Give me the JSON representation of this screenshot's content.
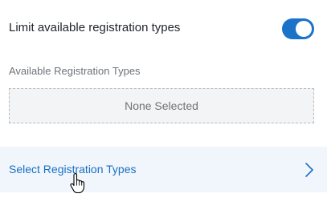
{
  "limit": {
    "label": "Limit available registration types",
    "toggle_on": true,
    "toggle_color": "#1a73c9"
  },
  "available": {
    "section_label": "Available Registration Types",
    "empty_text": "None Selected"
  },
  "select": {
    "label": "Select Registration Types",
    "icon": "chevron-right-icon",
    "link_color": "#1a6fc4"
  },
  "cursor": {
    "icon": "hand-pointer-cursor-icon"
  }
}
